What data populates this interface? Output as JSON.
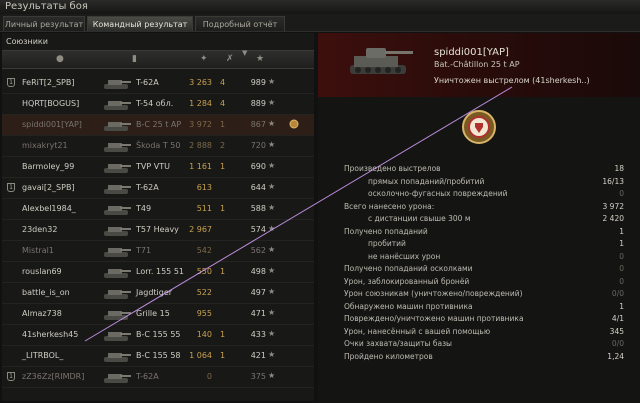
{
  "window": {
    "title": "Результаты боя"
  },
  "tabs": [
    {
      "label": "Личный результат",
      "active": false
    },
    {
      "label": "Командный результат",
      "active": true
    },
    {
      "label": "Подробный отчёт",
      "active": false
    }
  ],
  "team": {
    "title": "Союзники"
  },
  "columns": {
    "sort_icon": "sort-down-icon",
    "icons": [
      "player-icon",
      "tank-icon",
      "damage-icon",
      "kills-icon",
      "experience-icon"
    ]
  },
  "rows": [
    {
      "platoon": true,
      "name": "FeRiT[2_SPB]",
      "tank": "T-62A",
      "damage": "3 263",
      "kills": "4",
      "xp": "989",
      "dead": false,
      "highlight": false
    },
    {
      "platoon": false,
      "name": "HQRT[BOGUS]",
      "tank": "T-54 обл.",
      "damage": "1 284",
      "kills": "4",
      "xp": "889",
      "dead": false,
      "highlight": false
    },
    {
      "platoon": false,
      "name": "spiddi001[YAP]",
      "tank": "B-C 25 t AP",
      "damage": "3 972",
      "kills": "1",
      "xp": "867",
      "dead": true,
      "highlight": true,
      "medal": true
    },
    {
      "platoon": false,
      "name": "mixakryt21",
      "tank": "Škoda T 50",
      "damage": "2 888",
      "kills": "2",
      "xp": "720",
      "dead": true,
      "highlight": false
    },
    {
      "platoon": false,
      "name": "Barmoley_99",
      "tank": "TVP VTU",
      "damage": "1 161",
      "kills": "1",
      "xp": "690",
      "dead": false,
      "highlight": false
    },
    {
      "platoon": true,
      "name": "gavai[2_SPB]",
      "tank": "T-62A",
      "damage": "613",
      "kills": "",
      "xp": "644",
      "dead": false,
      "highlight": false
    },
    {
      "platoon": false,
      "name": "Alexbel1984_",
      "tank": "T49",
      "damage": "511",
      "kills": "1",
      "xp": "588",
      "dead": false,
      "highlight": false
    },
    {
      "platoon": false,
      "name": "23den32",
      "tank": "T57 Heavy",
      "damage": "2 967",
      "kills": "",
      "xp": "574",
      "dead": false,
      "highlight": false
    },
    {
      "platoon": false,
      "name": "Mistral1",
      "tank": "T71",
      "damage": "542",
      "kills": "",
      "xp": "562",
      "dead": true,
      "highlight": false
    },
    {
      "platoon": false,
      "name": "rouslan69",
      "tank": "Lorr. 155 51",
      "damage": "550",
      "kills": "1",
      "xp": "498",
      "dead": false,
      "highlight": false
    },
    {
      "platoon": false,
      "name": "battle_is_on",
      "tank": "Jagdtiger",
      "damage": "522",
      "kills": "",
      "xp": "497",
      "dead": false,
      "highlight": false
    },
    {
      "platoon": false,
      "name": "Almaz738",
      "tank": "Grille 15",
      "damage": "955",
      "kills": "",
      "xp": "471",
      "dead": false,
      "highlight": false
    },
    {
      "platoon": false,
      "name": "41sherkesh45",
      "tank": "B-C 155 55",
      "damage": "140",
      "kills": "1",
      "xp": "433",
      "dead": false,
      "highlight": false
    },
    {
      "platoon": false,
      "name": "_LITRBOL_",
      "tank": "B-C 155 58",
      "damage": "1 064",
      "kills": "1",
      "xp": "421",
      "dead": false,
      "highlight": false
    },
    {
      "platoon": true,
      "name": "zZ36Zz[RIMDR]",
      "tank": "T-62A",
      "damage": "0",
      "kills": "",
      "xp": "375",
      "dead": true,
      "highlight": false
    }
  ],
  "player": {
    "name": "spiddi001[YAP]",
    "vehicle": "Bat.-Châtillon 25 t AP",
    "status": "Уничтожен выстрелом (41sherkesh..)"
  },
  "stats": [
    {
      "label": "Произведено выстрелов",
      "value": "18",
      "indent": false,
      "dim": false
    },
    {
      "label": "прямых попаданий/пробитий",
      "value": "16/13",
      "indent": true,
      "dim": false
    },
    {
      "label": "осколочно-фугасных повреждений",
      "value": "0",
      "indent": true,
      "dim": true
    },
    {
      "label": "Всего нанесено урона:",
      "value": "3 972",
      "indent": false,
      "dim": false
    },
    {
      "label": "с дистанции свыше 300 м",
      "value": "2 420",
      "indent": true,
      "dim": false
    },
    {
      "label": "Получено попаданий",
      "value": "1",
      "indent": false,
      "dim": false
    },
    {
      "label": "пробитий",
      "value": "1",
      "indent": true,
      "dim": false
    },
    {
      "label": "не нанёсших урон",
      "value": "0",
      "indent": true,
      "dim": true
    },
    {
      "label": "Получено попаданий осколками",
      "value": "0",
      "indent": false,
      "dim": true
    },
    {
      "label": "Урон, заблокированный бронёй",
      "value": "0",
      "indent": false,
      "dim": true
    },
    {
      "label": "Урон союзникам (уничтожено/повреждений)",
      "value": "0/0",
      "indent": false,
      "dim": true
    },
    {
      "label": "Обнаружено машин противника",
      "value": "1",
      "indent": false,
      "dim": false
    },
    {
      "label": "Повреждено/уничтожено машин противника",
      "value": "4/1",
      "indent": false,
      "dim": false
    },
    {
      "label": "Урон, нанесённый с вашей помощью",
      "value": "345",
      "indent": false,
      "dim": false
    },
    {
      "label": "Очки захвата/защиты базы",
      "value": "0/0",
      "indent": false,
      "dim": true
    },
    {
      "label": "Пройдено километров",
      "value": "1,24",
      "indent": false,
      "dim": false
    }
  ],
  "colors": {
    "accent": "#c9a14d",
    "banner": "#3d0f0c",
    "annotation_line": "#d8a0ff"
  }
}
